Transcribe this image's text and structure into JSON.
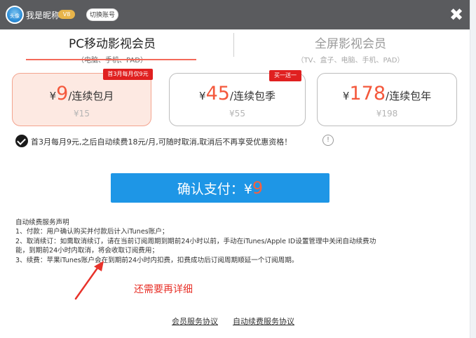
{
  "header": {
    "avatar_text": "头像",
    "nickname": "我是昵称",
    "vip_badge": "V8",
    "switch_account": "切换账号",
    "close_glyph": "✖"
  },
  "tabs": [
    {
      "title": "PC移动影视会员",
      "subtitle": "（电脑、手机、PAD）",
      "active": true
    },
    {
      "title": "全屏影视会员",
      "subtitle": "（TV、盒子、电脑、手机、PAD）",
      "active": false
    }
  ],
  "plans": [
    {
      "currency": "¥",
      "amount": "9",
      "period": "/连续包月",
      "original": "¥15",
      "ribbon": "首3月每月仅9元",
      "selected": true
    },
    {
      "currency": "¥",
      "amount": "45",
      "period": "/连续包季",
      "original": "¥55",
      "ribbon": "买一送一",
      "selected": false
    },
    {
      "currency": "¥",
      "amount": "178",
      "period": "/连续包年",
      "original": "¥198",
      "ribbon": "",
      "selected": false
    }
  ],
  "notice": {
    "text": "首3月每月9元,之后自动续费18元/月,可随时取消,取消后不再享受优惠资格！",
    "info_glyph": "!"
  },
  "pay_button": {
    "label": "确认支付：",
    "currency": "¥",
    "amount": "9"
  },
  "terms": {
    "title": "自动续费服务声明",
    "lines": [
      "1、付款：用户确认购买并付款后计入iTunes账户；",
      "2、取消续订：如需取消续订，请在当前订阅周期到期前24小时以前，手动在iTunes/Apple ID设置管理中关闭自动续费功",
      "能，到期前24小时内取消，将会收取订阅费用；",
      "3、续费：苹果iTunes账户会在到期前24小时内扣费，扣费成功后订阅周期顺延一个订阅周期。"
    ]
  },
  "annotation": {
    "text": "还需要再详细",
    "color": "#e8322a"
  },
  "footer": {
    "links": [
      "会员服务协议",
      "自动续费服务协议"
    ]
  },
  "colors": {
    "topbar": "#5a5b5e",
    "accent_price": "#f4583c",
    "pay_button": "#1e96e6",
    "selected_card": "#fde9e2",
    "ribbon": "#e02020"
  }
}
